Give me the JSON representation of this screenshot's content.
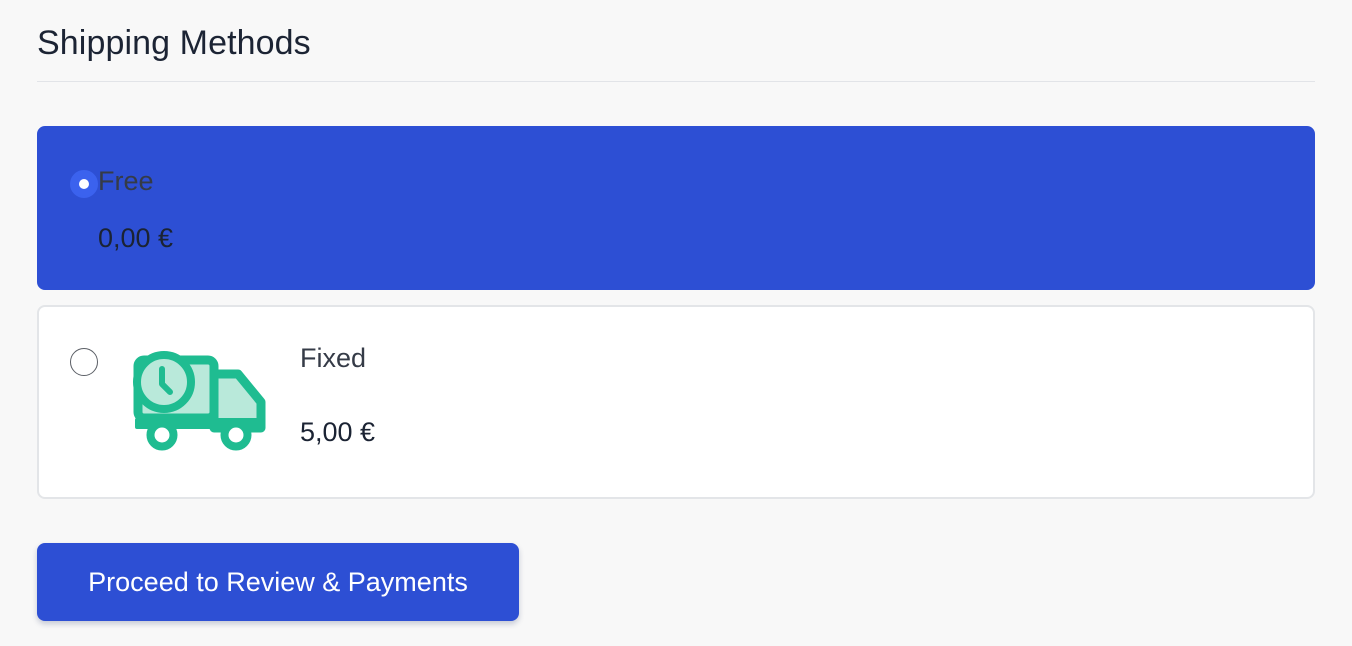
{
  "page": {
    "title": "Shipping Methods"
  },
  "colors": {
    "accent": "#2d4fd4",
    "radio_checked": "#3b62ee",
    "icon_green": "#1fbc91",
    "icon_green_light": "#b9e9da"
  },
  "shipping_methods": [
    {
      "name": "Free",
      "price": "0,00 €",
      "selected": true,
      "icon": null
    },
    {
      "name": "Fixed",
      "price": "5,00 €",
      "selected": false,
      "icon": "delivery-truck-clock-icon"
    }
  ],
  "actions": {
    "proceed_label": "Proceed to Review & Payments"
  }
}
